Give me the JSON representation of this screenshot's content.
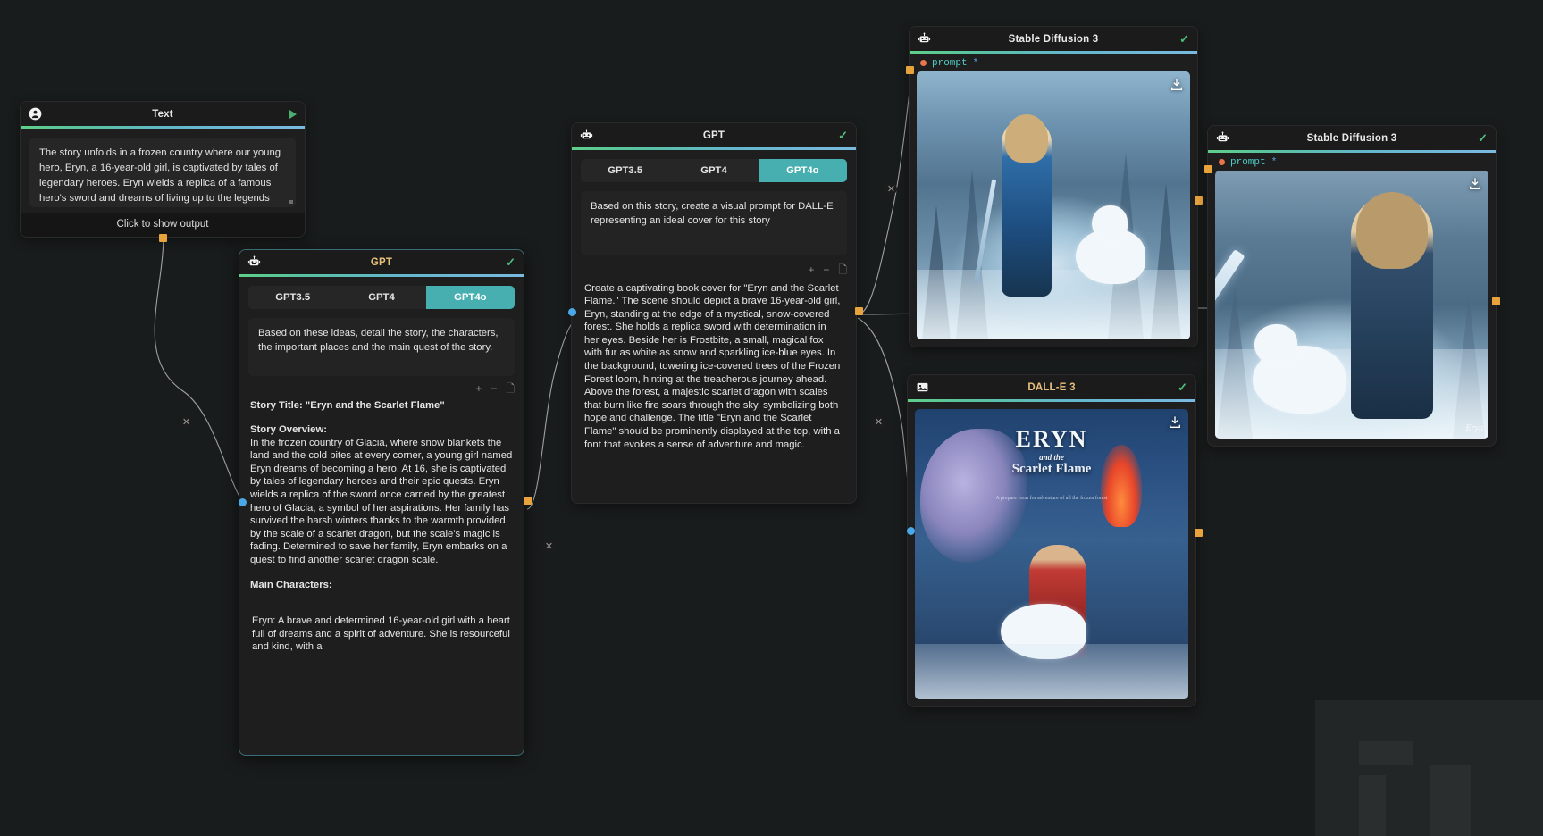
{
  "canvas": {
    "background": "#181818",
    "accent_teal": "#47afb0",
    "accent_green": "#5fcf8a",
    "port_orange": "#e8a33d",
    "port_blue": "#4aa8e8"
  },
  "nodes": {
    "text_node": {
      "title": "Text",
      "icon": "user-icon",
      "run_icon": "play-icon",
      "value": "The story unfolds in a frozen country where our young hero, Eryn, a 16-year-old girl, is captivated by tales of legendary heroes. Eryn wields a replica of a famous hero's sword and dreams of living up to the legends she's always admired. Her",
      "footer_label": "Click to show output"
    },
    "gpt_story": {
      "title": "GPT",
      "icon": "robot-icon",
      "status_icon": "check-icon",
      "tabs": [
        "GPT3.5",
        "GPT4",
        "GPT4o"
      ],
      "active_tab": "GPT4o",
      "prompt": "Based on these ideas, detail the story, the characters, the important places and the main quest of the story.",
      "toolbar": [
        "+",
        "−",
        "copy-icon"
      ],
      "output": {
        "title_line": "Story Title: \"Eryn and the Scarlet Flame\"",
        "overview_heading": "Story Overview:",
        "overview_body": "In the frozen country of Glacia, where snow blankets the land and the cold bites at every corner, a young girl named Eryn dreams of becoming a hero. At 16, she is captivated by tales of legendary heroes and their epic quests. Eryn wields a replica of the sword once carried by the greatest hero of Glacia, a symbol of her aspirations. Her family has survived the harsh winters thanks to the warmth provided by the scale of a scarlet dragon, but the scale's magic is fading. Determined to save her family, Eryn embarks on a quest to find another scarlet dragon scale.",
        "characters_heading": "Main Characters:",
        "characters_body": "Eryn: A brave and determined 16-year-old girl with a heart full of dreams and a spirit of adventure. She is resourceful and kind, with a"
      }
    },
    "gpt_prompt": {
      "title": "GPT",
      "icon": "robot-icon",
      "status_icon": "check-icon",
      "tabs": [
        "GPT3.5",
        "GPT4",
        "GPT4o"
      ],
      "active_tab": "GPT4o",
      "prompt": "Based on this story, create a visual prompt for DALL-E representing an ideal cover for this story",
      "toolbar": [
        "+",
        "−",
        "copy-icon"
      ],
      "output": "Create a captivating book cover for \"Eryn and the Scarlet Flame.\" The scene should depict a brave 16-year-old girl, Eryn, standing at the edge of a mystical, snow-covered forest. She holds a replica sword with determination in her eyes. Beside her is Frostbite, a small, magical fox with fur as white as snow and sparkling ice-blue eyes. In the background, towering ice-covered trees of the Frozen Forest loom, hinting at the treacherous journey ahead. Above the forest, a majestic scarlet dragon with scales that burn like fire soars through the sky, symbolizing both hope and challenge. The title \"Eryn and the Scarlet Flame\" should be prominently displayed at the top, with a font that evokes a sense of adventure and magic."
    },
    "sd_top": {
      "title": "Stable Diffusion 3",
      "icon": "robot-icon",
      "status_icon": "check-icon",
      "port_label": "prompt",
      "port_required": "*",
      "download_icon": "download-icon",
      "image_alt": "Eryn in blue cloak with sword beside white fox in snowy forest"
    },
    "sd_right": {
      "title": "Stable Diffusion 3",
      "icon": "robot-icon",
      "status_icon": "check-icon",
      "port_label": "prompt",
      "port_required": "*",
      "download_icon": "download-icon",
      "image_alt": "Eryn holding a large icy sword with white fox in a snowy landscape",
      "signature": "Eryn"
    },
    "dalle": {
      "title": "DALL-E 3",
      "icon": "image-icon",
      "status_icon": "check-icon",
      "download_icon": "download-icon",
      "cover": {
        "line1": "ERYN",
        "line2": "and the",
        "line3": "Scarlet Flame",
        "subtitle": "A prepare form for adventure of all the frozen forest"
      }
    }
  }
}
